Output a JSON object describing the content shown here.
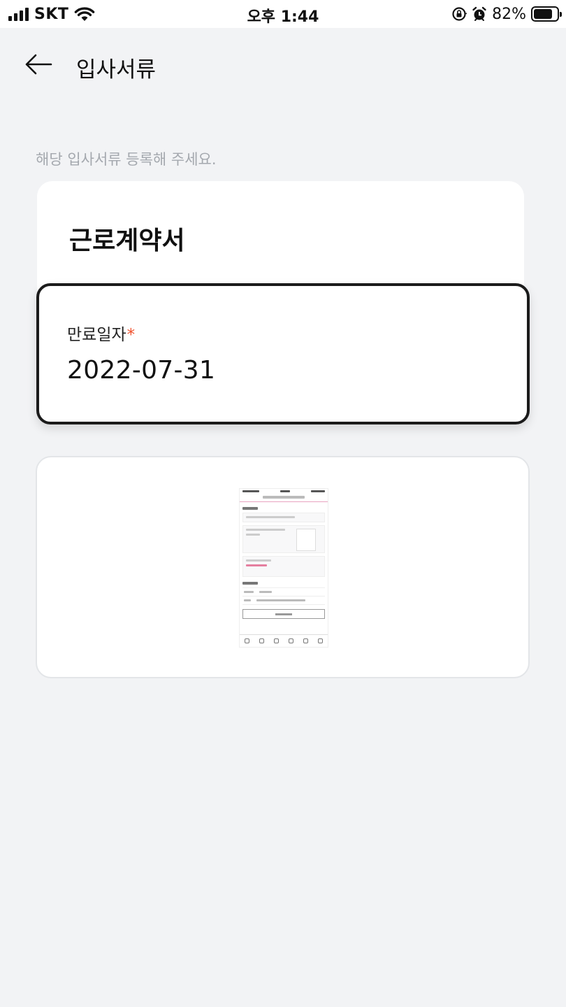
{
  "status_bar": {
    "carrier": "SKT",
    "time": "오후 1:44",
    "battery_percent": "82%",
    "battery_level": 0.82,
    "icons": [
      "signal-bars-icon",
      "wifi-icon",
      "orientation-lock-icon",
      "alarm-icon",
      "battery-icon"
    ]
  },
  "header": {
    "back_icon": "arrow-left-icon",
    "title": "입사서류"
  },
  "main": {
    "subtitle": "해당 입사서류 등록해 주세요.",
    "document": {
      "title": "근로계약서"
    },
    "expiration": {
      "label": "만료일자",
      "required_mark": "*",
      "value": "2022-07-31"
    },
    "attachment": {
      "kind": "screenshot-thumbnail"
    }
  },
  "colors": {
    "background": "#f2f3f5",
    "card": "#ffffff",
    "focused_border": "#1b1b1b",
    "required": "#f0522e",
    "subtitle": "#a4a8ae"
  }
}
